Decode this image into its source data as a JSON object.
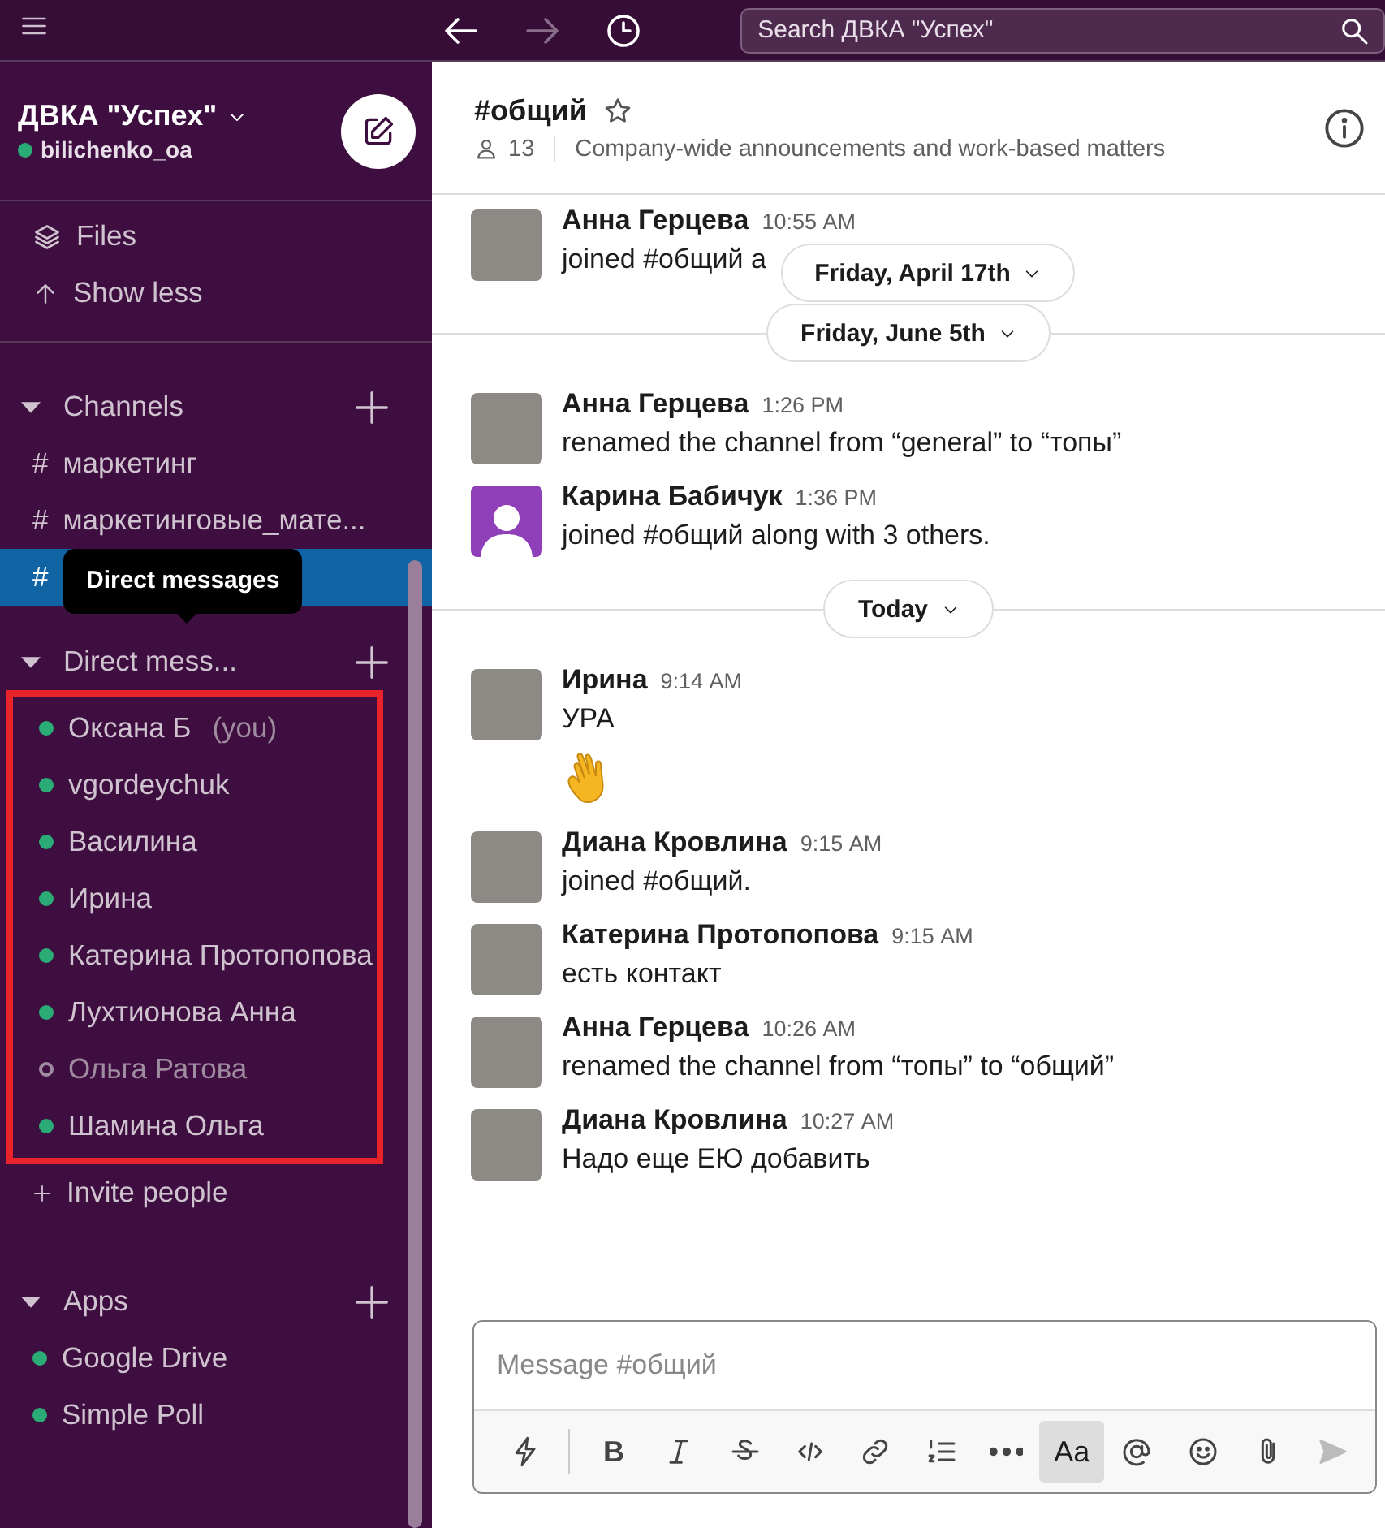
{
  "topbar": {
    "search": {
      "placeholder": "Search ДВКА \"Успех\""
    }
  },
  "workspace": {
    "name": "ДВКА \"Успех\"",
    "user": "bilichenko_oa",
    "online": true
  },
  "nav": [
    {
      "kind": "files",
      "label": "Files"
    },
    {
      "kind": "collapse",
      "label": "Show less"
    }
  ],
  "channels": {
    "title": "Channels",
    "expanded": true,
    "items": [
      {
        "prefix": "#",
        "name": "маркетинг",
        "selected": false
      },
      {
        "prefix": "#",
        "name": "маркетинговые_мате...",
        "selected": false
      },
      {
        "prefix": "#",
        "selected": true
      }
    ]
  },
  "tooltip": {
    "text": "Direct messages"
  },
  "direct_messages": {
    "title": "Direct mess...",
    "expanded": true,
    "items": [
      {
        "name": "Оксана Б",
        "suffix": "(you)",
        "online": true
      },
      {
        "name": "vgordeychuk",
        "online": true
      },
      {
        "name": "Василина",
        "online": true
      },
      {
        "name": "Ирина",
        "online": true
      },
      {
        "name": "Катерина Протопопова",
        "online": true
      },
      {
        "name": "Лухтионова Анна",
        "online": true
      },
      {
        "name": "Ольга Ратова",
        "online": false
      },
      {
        "name": "Шамина Ольга",
        "online": true
      }
    ],
    "invite": "Invite people"
  },
  "apps": {
    "title": "Apps",
    "expanded": true,
    "items": [
      {
        "name": "Google Drive",
        "online": true
      },
      {
        "name": "Simple Poll",
        "online": true
      }
    ]
  },
  "channel_header": {
    "name": "#общий",
    "starred": false,
    "members": "13",
    "topic": "Company-wide announcements and work-based matters"
  },
  "floating_date": "Friday, April 17th",
  "feed": [
    {
      "kind": "message",
      "avatar": {
        "kind": "photo"
      },
      "author": "Анна Герцева",
      "time": "10:55 AM",
      "text": "joined #общий a",
      "big_emoji": false
    },
    {
      "kind": "date",
      "label": "Friday, June 5th"
    },
    {
      "kind": "message",
      "avatar": {
        "kind": "photo"
      },
      "author": "Анна Герцева",
      "time": "1:26 PM",
      "text": "renamed the channel from “general” to “топы”",
      "big_emoji": false
    },
    {
      "kind": "message",
      "avatar": {
        "kind": "default"
      },
      "author": "Карина Бабичук",
      "time": "1:36 PM",
      "text": "joined #общий along with 3 others.",
      "big_emoji": false
    },
    {
      "kind": "date",
      "label": "Today"
    },
    {
      "kind": "message",
      "avatar": {
        "kind": "photo"
      },
      "author": "Ирина",
      "time": "9:14 AM",
      "text": "УРА",
      "big_emoji": true
    },
    {
      "kind": "message",
      "avatar": {
        "kind": "photo"
      },
      "author": "Диана Кровлина",
      "time": "9:15 AM",
      "text": "joined #общий.",
      "big_emoji": false
    },
    {
      "kind": "message",
      "avatar": {
        "kind": "photo"
      },
      "author": "Катерина Протопопова",
      "time": "9:15 AM",
      "text": "есть контакт",
      "big_emoji": false
    },
    {
      "kind": "message",
      "avatar": {
        "kind": "photo"
      },
      "author": "Анна Герцева",
      "time": "10:26 AM",
      "text": "renamed the channel from “топы” to “общий”",
      "big_emoji": false
    },
    {
      "kind": "message",
      "avatar": {
        "kind": "photo"
      },
      "author": "Диана Кровлина",
      "time": "10:27 AM",
      "text": "Надо еще ЕЮ добавить",
      "big_emoji": false
    }
  ],
  "composer": {
    "placeholder": "Message #общий",
    "bold_label": "B",
    "format_toggle": {
      "label": "Aa",
      "selected": true
    }
  }
}
